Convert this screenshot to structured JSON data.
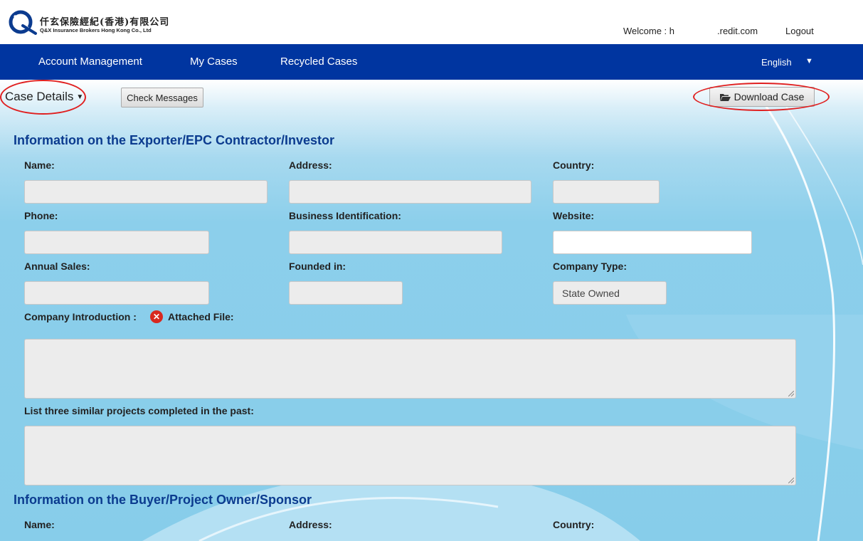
{
  "brand": {
    "name_cn": "仟玄保險經紀(香港)有限公司",
    "name_en": "Q&X Insurance Brokers Hong Kong Co., Ltd"
  },
  "header": {
    "welcome_prefix": "Welcome : h",
    "welcome_suffix": ".redit.com",
    "logout": "Logout"
  },
  "nav": {
    "items": [
      "Account Management",
      "My Cases",
      "Recycled Cases"
    ],
    "language": "English"
  },
  "toolbar": {
    "case_details": "Case Details",
    "check_messages": "Check Messages",
    "download_case": "Download Case"
  },
  "section1": {
    "title": "Information on the Exporter/EPC Contractor/Investor",
    "name_label": "Name:",
    "address_label": "Address:",
    "country_label": "Country:",
    "phone_label": "Phone:",
    "business_id_label": "Business Identification:",
    "website_label": "Website:",
    "annual_sales_label": "Annual Sales:",
    "founded_label": "Founded in:",
    "company_type_label": "Company Type:",
    "company_type_value": "State Owned",
    "company_intro_label": "Company Introduction :",
    "attached_file_label": "Attached File:",
    "projects_label": "List three similar projects completed in the past:"
  },
  "section2": {
    "title": "Information on the Buyer/Project Owner/Sponsor",
    "name_label": "Name:",
    "address_label": "Address:",
    "country_label": "Country:"
  },
  "colors": {
    "nav_bg": "#0035a0",
    "title_blue": "#0b3b8f",
    "annotation_red": "#e02020",
    "error_red": "#d8281f"
  }
}
